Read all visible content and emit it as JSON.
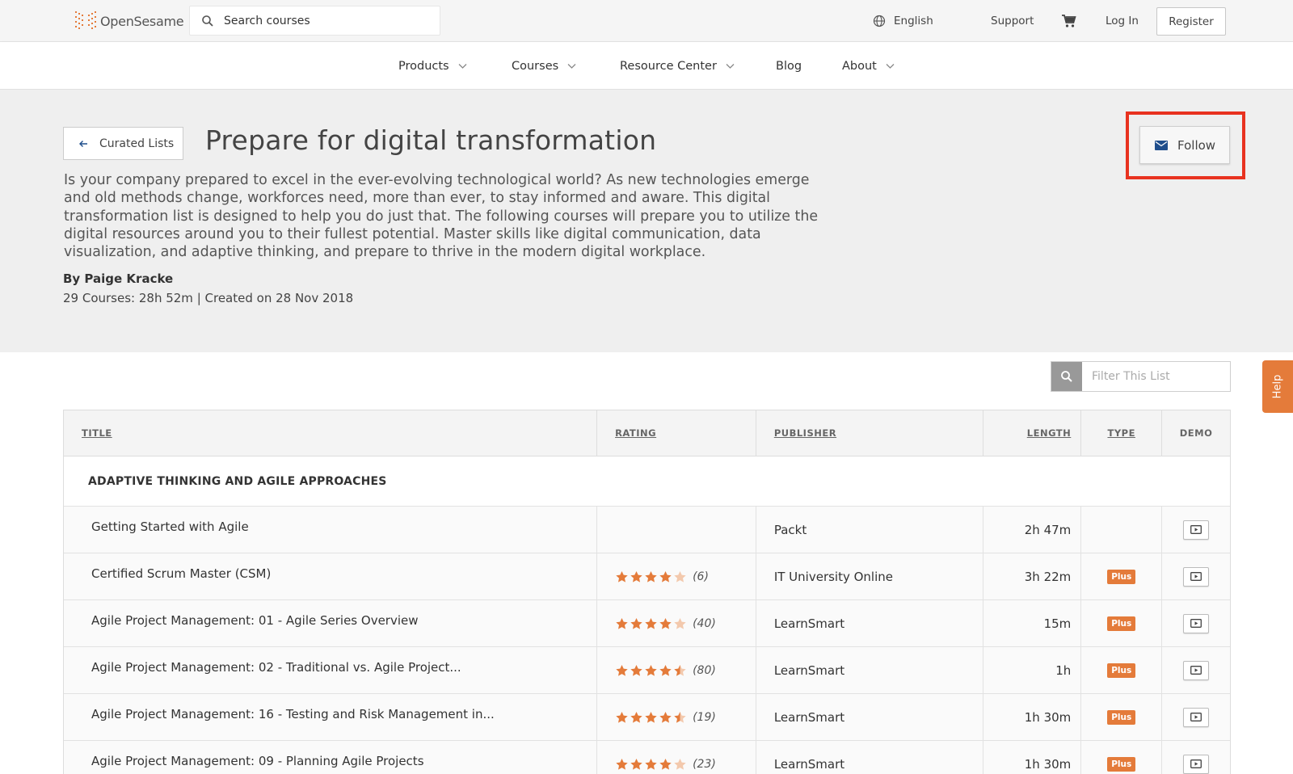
{
  "header": {
    "logo_text": "OpenSesame",
    "search_placeholder": "Search courses",
    "language": "English",
    "support": "Support",
    "login": "Log In",
    "register": "Register"
  },
  "nav": {
    "items": [
      {
        "label": "Products",
        "dropdown": true
      },
      {
        "label": "Courses",
        "dropdown": true
      },
      {
        "label": "Resource Center",
        "dropdown": true
      },
      {
        "label": "Blog",
        "dropdown": false
      },
      {
        "label": "About",
        "dropdown": true
      }
    ]
  },
  "hero": {
    "back_label": "Curated Lists",
    "title": "Prepare for digital transformation",
    "follow_label": "Follow",
    "description": "Is your company prepared to excel in the ever-evolving technological world? As new technologies emerge and old methods change, workforces need, more than ever, to stay informed and aware. This digital transformation list is designed to help you do just that. The following courses will prepare you to utilize the digital resources around you to their fullest potential. Master skills like digital communication, data visualization, and adaptive thinking, and prepare to thrive in the modern digital workplace.",
    "author": "By Paige Kracke",
    "meta": "29 Courses: 28h 52m | Created on 28 Nov 2018"
  },
  "filter": {
    "placeholder": "Filter This List"
  },
  "help_label": "Help",
  "table": {
    "headers": {
      "title": "TITLE",
      "rating": "RATING",
      "publisher": "PUBLISHER",
      "length": "LENGTH",
      "type": "TYPE",
      "demo": "DEMO"
    },
    "group": "ADAPTIVE THINKING AND AGILE APPROACHES",
    "rows": [
      {
        "title": "Getting Started with Agile",
        "rating": null,
        "count": "",
        "publisher": "Packt",
        "length": "2h 47m",
        "type": ""
      },
      {
        "title": "Certified Scrum Master (CSM)",
        "rating": 4,
        "count": "(6)",
        "publisher": "IT University Online",
        "length": "3h 22m",
        "type": "Plus"
      },
      {
        "title": "Agile Project Management: 01 - Agile Series Overview",
        "rating": 4,
        "count": "(40)",
        "publisher": "LearnSmart",
        "length": "15m",
        "type": "Plus"
      },
      {
        "title": "Agile Project Management: 02 - Traditional vs. Agile Project...",
        "rating": 4.5,
        "count": "(80)",
        "publisher": "LearnSmart",
        "length": "1h",
        "type": "Plus"
      },
      {
        "title": "Agile Project Management: 16 - Testing and Risk Management in...",
        "rating": 4.5,
        "count": "(19)",
        "publisher": "LearnSmart",
        "length": "1h 30m",
        "type": "Plus"
      },
      {
        "title": "Agile Project Management: 09 - Planning Agile Projects",
        "rating": 4,
        "count": "(23)",
        "publisher": "LearnSmart",
        "length": "1h 30m",
        "type": "Plus"
      }
    ]
  },
  "colors": {
    "accent_orange": "#e47b3a",
    "highlight_red": "#e8321f",
    "mail_blue": "#1f4e8c"
  }
}
